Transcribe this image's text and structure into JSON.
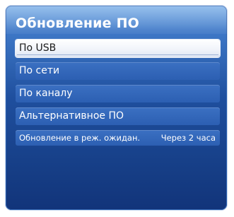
{
  "window": {
    "title": "Обновление ПО"
  },
  "menu": {
    "items": [
      {
        "label": "По USB",
        "selected": true
      },
      {
        "label": "По сети",
        "selected": false
      },
      {
        "label": "По каналу",
        "selected": false
      },
      {
        "label": "Альтернативное ПО",
        "selected": false
      }
    ],
    "standby_update": {
      "label": "Обновление в реж. ожидан.",
      "value": "Через 2 часа"
    }
  },
  "colors": {
    "panel_top": "#6fa8e6",
    "panel_bottom": "#12347a",
    "item_bg": "#2c5fb2",
    "selected_bg": "#ffffff"
  }
}
